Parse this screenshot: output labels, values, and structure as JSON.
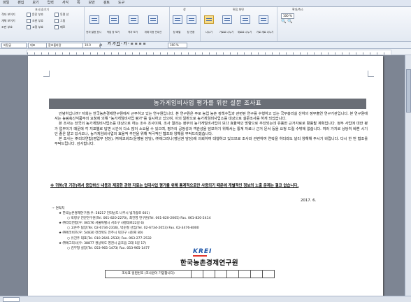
{
  "menubar": {
    "items": [
      "파일",
      "편집",
      "보기",
      "입력",
      "서식",
      "쪽",
      "보안",
      "검토",
      "도구"
    ]
  },
  "ribbon": {
    "group1_title": "표시/숨기기",
    "group1_left": [
      "격자 보이기",
      "개체 보이기",
      "조판 부호"
    ],
    "group1_checks": [
      "문단 부호",
      "조판 부호",
      "교정 부호",
      "투명 선",
      "그림",
      "메모"
    ],
    "group2_buttons": [
      "한자 발음 표시",
      "작업 창 보기",
      "격자 보기",
      "개체 이동 안내선"
    ],
    "group3_title": "창",
    "group3_buttons": [
      "창 배열",
      "창 전환"
    ],
    "group4_title": "편집 화면",
    "group4_buttons": [
      "나누기",
      "가로로 나누기",
      "세로로 나누기",
      "가로 세로 나누기"
    ],
    "group5_title": "확대/축소",
    "zoom": "100 %"
  },
  "formatbar": {
    "style": "바탕글",
    "font_lang": "대표",
    "font_name": "함초롬바탕",
    "font_size": "10.0",
    "unit": "pt",
    "line_spacing": "160 %"
  },
  "document": {
    "title": "농가게임비사업 평가를 위한 설문 조사표",
    "paragraphs": [
      "안녕하십니까? 저희는 한국농촌경제연구원에서 근무하고 있는 연구원입니다. 본 연구원은 주로 농업 농촌 정책수립과 관련된 연구를 수행하고 있는 국무총리실 산하의 정부출연 연구기관입니다. 본 연구원에서는 농림축산식품부의 요청에 의해 \"농가게임비사업 평가\"를 실시하고 있으며, 이의 일환으로 농가게임비사업소를 대상으로 설문조사를 하게 되었습니다.",
      "본 조사는 전국의 농가게임비사업소를 대상으로 하는 조수 조사이며, 조사 결과는 정부의 농가게임비사업이 보다 효율적인 방향으로 추진되는데 유용한 근거자료로 활용될 계획입니다. 정부 사업에 대한 평가 업무이기 때문에 각 지표별로 답변 시간이 다소 많이 소요될 수 있으며, 평가의 공정성과 객관성을 담보하기 위해서는 통계 자료나 근거 문서 등을 요청 드릴 수밖에 없습니다. 여러 가지로 상당히 바쁜 시기인 줄은 알고 있사오나, 농가게임비사업의 효율적 추진을 위해 적극적인 협조와 양해를 부탁드리겠습니다.",
      "본 조사는 ㈜리더연합(영업부 담당), ㈜에코비즈(운영팀 담당), ㈜에그리나(영남권 담당)에 의뢰하여 대행하고 있으므로 조사와 관련하여 연락을 하더라도 널리 양해해 주시기 바랍니다. 다시 한 번 협조를 부탁드립니다. 감사합니다."
    ],
    "notice": "※ 귀하(귀 기관)께서 응답하신 내용과 제공한 관련 자료는 업대사업 평가를 위해 통계적으로만 사용되기 때문에 개별적인 정보의 노출 문제는 결코 없습니다.",
    "date": "2017. 6.",
    "contacts_title": "☞ 연락처",
    "contacts": [
      {
        "level": 1,
        "text": "★ 한국농촌경제연구원(우: 58217 전라남도 나주시 빛가람로 601)"
      },
      {
        "level": 2,
        "text": "○ 박병규 전문연구원(Tel. 061-820-2270), 최진영 연구원(Tel. 061-820-2065)   Fax. 061-820-2414"
      },
      {
        "level": 1,
        "text": "★ ㈜리더연합(우: 06576 서울특별시 서초구 사평대로22길 6)"
      },
      {
        "level": 2,
        "text": "○ 고은주 팀장(Tel. 02-6734-2316), 박순철 선임(Tel. 02-6734-2053)  Fax. 02-3476-8000"
      },
      {
        "level": 1,
        "text": "★ ㈜에코비즈(우: 54830 전라북도 전주시 덕진구 시천로 80)"
      },
      {
        "level": 2,
        "text": "○ 유진주 대표(Tel. 010-2641-2532)  Fax. 063-277-2532"
      },
      {
        "level": 1,
        "text": "★ ㈜에그리나(우: 38877 경상북도 영천시 금호읍 고대 5길 17)"
      },
      {
        "level": 2,
        "text": "○ 김무형 실장(Tel. 053-965-1473)  Fax. 053-965-1477"
      }
    ],
    "logo_text": "KREI",
    "org_name": "한국농촌경제연구원",
    "serial_label": "조사표 일련번호 (조사원이 기입합니다)"
  }
}
